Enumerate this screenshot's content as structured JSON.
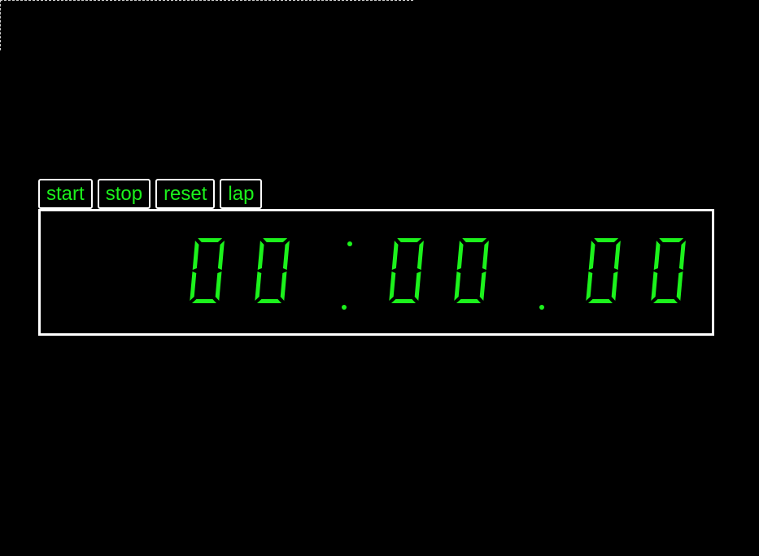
{
  "controls": {
    "start_label": "start",
    "stop_label": "stop",
    "reset_label": "reset",
    "lap_label": "lap"
  },
  "display": {
    "time_text": "00:00.00",
    "digits": [
      "0",
      "0",
      "0",
      "0",
      "0",
      "0"
    ],
    "separators": [
      ":",
      "."
    ],
    "digit_color": "#1cf21c",
    "border_color": "#ffffff",
    "background_color": "#000000"
  }
}
